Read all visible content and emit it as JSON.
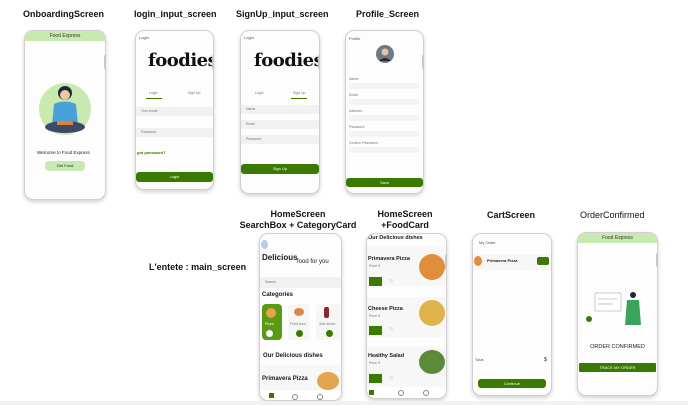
{
  "screens": {
    "onboarding": {
      "title": "OnboardingScreen",
      "header": "Food Express",
      "welcome": "Welcome to Food Express",
      "button": "Get Food"
    },
    "login": {
      "title": "login_input_screen",
      "header": "Login",
      "logo": "foodies",
      "tab_login": "Login",
      "tab_signup": "Sign Up",
      "field1": "Your email",
      "field2": "Password",
      "forgot": "got password?",
      "button": "Login"
    },
    "signup": {
      "title": "SignUp_input_screen",
      "header": "Login",
      "logo": "foodies",
      "tab_login": "Login",
      "tab_signup": "Sign Up",
      "field1": "Name",
      "field2": "Email",
      "field3": "Password",
      "button": "Sign Up"
    },
    "profile": {
      "title": "Profile_Screen",
      "header": "Profile",
      "rows": [
        "Name",
        "Email",
        "Address",
        "Password",
        "Confirm Password"
      ],
      "button": "Save"
    },
    "home1": {
      "title": "HomeScreen",
      "subtitle": "SearchBox + CategoryCard",
      "delicious": "Delicious",
      "food_for_you": "food for you",
      "search": "Search",
      "categories": "Categories",
      "cat_items": [
        "Pizza",
        "Fried food",
        "Soft drinks"
      ],
      "our_dishes": "Our Delicious dishes",
      "dish": "Primavera Pizza"
    },
    "home2": {
      "title": "HomeScreen",
      "subtitle": "+FoodCard",
      "heading": "Our Delicious dishes",
      "dishes": [
        {
          "name": "Primavera Pizza",
          "price": "Price 9"
        },
        {
          "name": "Cheese Pizza",
          "price": "Price 9"
        },
        {
          "name": "Healthy Salad",
          "price": "Price 9"
        }
      ]
    },
    "cart": {
      "title": "CartScreen",
      "header": "My Order",
      "item": "Primavera Pizza",
      "total": "Total",
      "button": "Continue"
    },
    "confirmed": {
      "title": "OrderConfirmed",
      "header": "Food Express",
      "message": "ORDER CONFIRMED",
      "button": "TRACK MY ORDER"
    }
  },
  "side_label": "L'entete : main_screen",
  "colors": {
    "green": "#3a7a00",
    "light_green": "#c8eab0"
  }
}
